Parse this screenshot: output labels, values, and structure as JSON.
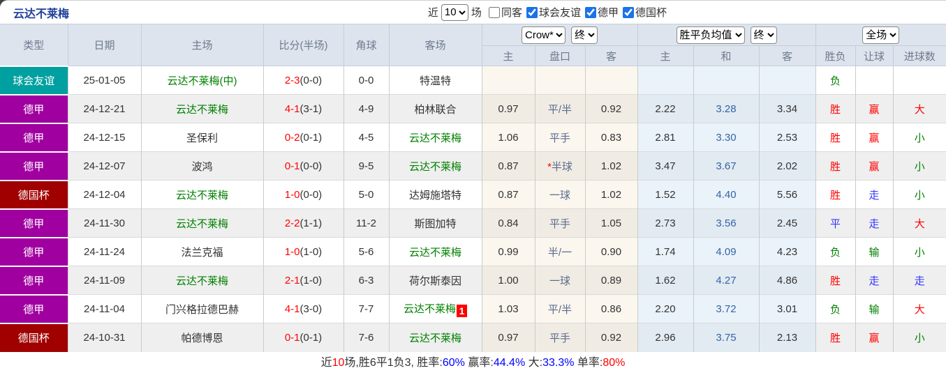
{
  "page_title": "云达不莱梅",
  "topbar": {
    "recent_prefix": "近",
    "recent_value": "10",
    "recent_suffix": "场",
    "checkboxes": [
      {
        "label": "同客",
        "checked": false
      },
      {
        "label": "球会友谊",
        "checked": true
      },
      {
        "label": "德甲",
        "checked": true
      },
      {
        "label": "德国杯",
        "checked": true
      }
    ]
  },
  "table": {
    "columns": [
      "类型",
      "日期",
      "主场",
      "比分(半场)",
      "角球",
      "客场"
    ],
    "odds_group": {
      "source_select": "Crow*",
      "time_select": "终"
    },
    "avg_group": {
      "source_select": "胜平负均值",
      "time_select": "终"
    },
    "scope_select": "全场",
    "sub_columns": [
      "主",
      "盘口",
      "客",
      "主",
      "和",
      "客",
      "胜负",
      "让球",
      "进球数"
    ],
    "rows": [
      {
        "type": "球会友谊",
        "date": "25-01-05",
        "home": "云达不莱梅(中)",
        "home_target": true,
        "score_ft": "2-3",
        "score_ht": "(0-0)",
        "corner": "0-0",
        "away": "特温特",
        "away_target": false,
        "away_badge": "",
        "odds": [
          "",
          "",
          ""
        ],
        "handicap_star": false,
        "avg": [
          "",
          "",
          ""
        ],
        "results": [
          "负",
          "",
          ""
        ]
      },
      {
        "type": "德甲",
        "date": "24-12-21",
        "home": "云达不莱梅",
        "home_target": true,
        "score_ft": "4-1",
        "score_ht": "(3-1)",
        "corner": "4-9",
        "away": "柏林联合",
        "away_target": false,
        "away_badge": "",
        "odds": [
          "0.97",
          "平/半",
          "0.92"
        ],
        "handicap_star": false,
        "avg": [
          "2.22",
          "3.28",
          "3.34"
        ],
        "results": [
          "胜",
          "赢",
          "大"
        ]
      },
      {
        "type": "德甲",
        "date": "24-12-15",
        "home": "圣保利",
        "home_target": false,
        "score_ft": "0-2",
        "score_ht": "(0-1)",
        "corner": "4-5",
        "away": "云达不莱梅",
        "away_target": true,
        "away_badge": "",
        "odds": [
          "1.06",
          "平手",
          "0.83"
        ],
        "handicap_star": false,
        "avg": [
          "2.81",
          "3.30",
          "2.53"
        ],
        "results": [
          "胜",
          "赢",
          "小"
        ]
      },
      {
        "type": "德甲",
        "date": "24-12-07",
        "home": "波鸿",
        "home_target": false,
        "score_ft": "0-1",
        "score_ht": "(0-0)",
        "corner": "9-5",
        "away": "云达不莱梅",
        "away_target": true,
        "away_badge": "",
        "odds": [
          "0.87",
          "半球",
          "1.02"
        ],
        "handicap_star": true,
        "avg": [
          "3.47",
          "3.67",
          "2.02"
        ],
        "results": [
          "胜",
          "赢",
          "小"
        ]
      },
      {
        "type": "德国杯",
        "date": "24-12-04",
        "home": "云达不莱梅",
        "home_target": true,
        "score_ft": "1-0",
        "score_ht": "(0-0)",
        "corner": "5-0",
        "away": "达姆施塔特",
        "away_target": false,
        "away_badge": "",
        "odds": [
          "0.87",
          "一球",
          "1.02"
        ],
        "handicap_star": false,
        "avg": [
          "1.52",
          "4.40",
          "5.56"
        ],
        "results": [
          "胜",
          "走",
          "小"
        ]
      },
      {
        "type": "德甲",
        "date": "24-11-30",
        "home": "云达不莱梅",
        "home_target": true,
        "score_ft": "2-2",
        "score_ht": "(1-1)",
        "corner": "11-2",
        "away": "斯图加特",
        "away_target": false,
        "away_badge": "",
        "odds": [
          "0.84",
          "平手",
          "1.05"
        ],
        "handicap_star": false,
        "avg": [
          "2.73",
          "3.56",
          "2.45"
        ],
        "results": [
          "平",
          "走",
          "大"
        ]
      },
      {
        "type": "德甲",
        "date": "24-11-24",
        "home": "法兰克福",
        "home_target": false,
        "score_ft": "1-0",
        "score_ht": "(1-0)",
        "corner": "5-6",
        "away": "云达不莱梅",
        "away_target": true,
        "away_badge": "",
        "odds": [
          "0.99",
          "半/一",
          "0.90"
        ],
        "handicap_star": false,
        "avg": [
          "1.74",
          "4.09",
          "4.23"
        ],
        "results": [
          "负",
          "输",
          "小"
        ]
      },
      {
        "type": "德甲",
        "date": "24-11-09",
        "home": "云达不莱梅",
        "home_target": true,
        "score_ft": "2-1",
        "score_ht": "(1-0)",
        "corner": "6-3",
        "away": "荷尔斯泰因",
        "away_target": false,
        "away_badge": "",
        "odds": [
          "1.00",
          "一球",
          "0.89"
        ],
        "handicap_star": false,
        "avg": [
          "1.62",
          "4.27",
          "4.86"
        ],
        "results": [
          "胜",
          "走",
          "走"
        ]
      },
      {
        "type": "德甲",
        "date": "24-11-04",
        "home": "门兴格拉德巴赫",
        "home_target": false,
        "score_ft": "4-1",
        "score_ht": "(3-0)",
        "corner": "7-7",
        "away": "云达不莱梅",
        "away_target": true,
        "away_badge": "1",
        "odds": [
          "1.03",
          "平/半",
          "0.86"
        ],
        "handicap_star": false,
        "avg": [
          "2.20",
          "3.72",
          "3.01"
        ],
        "results": [
          "负",
          "输",
          "大"
        ]
      },
      {
        "type": "德国杯",
        "date": "24-10-31",
        "home": "帕德博恩",
        "home_target": false,
        "score_ft": "0-1",
        "score_ht": "(0-1)",
        "corner": "7-6",
        "away": "云达不莱梅",
        "away_target": true,
        "away_badge": "",
        "odds": [
          "0.97",
          "平手",
          "0.92"
        ],
        "handicap_star": false,
        "avg": [
          "2.96",
          "3.75",
          "2.13"
        ],
        "results": [
          "胜",
          "赢",
          "小"
        ]
      }
    ]
  },
  "footer": {
    "segments": [
      {
        "text": "近",
        "color": "#333333"
      },
      {
        "text": "10",
        "color": "#FF0000"
      },
      {
        "text": "场,胜6平1负3, 胜率:",
        "color": "#333333"
      },
      {
        "text": "60%",
        "color": "#0000FF"
      },
      {
        "text": " 赢率:",
        "color": "#333333"
      },
      {
        "text": "44.4%",
        "color": "#0000FF"
      },
      {
        "text": " 大:",
        "color": "#333333"
      },
      {
        "text": "33.3%",
        "color": "#0000FF"
      },
      {
        "text": " 单率:",
        "color": "#333333"
      },
      {
        "text": "80%",
        "color": "#FF0000"
      }
    ]
  },
  "colors": {
    "title": "#20409A",
    "type_bg": {
      "球会友谊": "#00A0A0",
      "德甲": "#A000A0",
      "德国杯": "#A00000"
    },
    "target_team": "#008000",
    "score_ft": "#FF0000",
    "score_ht": "#333333",
    "handicap": "#5A6B8F",
    "avg_draw": "#3563A5",
    "result_text": {
      "胜": "#FF0000",
      "平": "#3333FF",
      "负": "#008000",
      "赢": "#FF0000",
      "走": "#3333FF",
      "输": "#008000",
      "大": "#FF0000",
      "小": "#008000"
    }
  }
}
